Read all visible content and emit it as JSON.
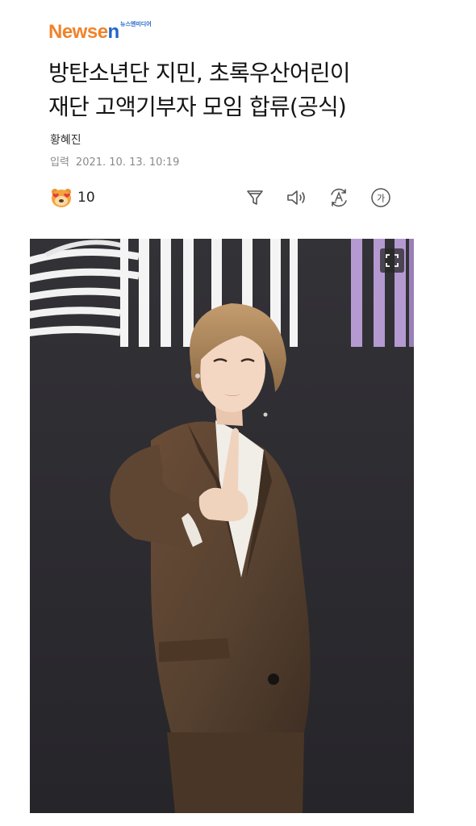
{
  "header": {
    "logo_main": "Newse",
    "logo_tail": "n",
    "logo_sub": "뉴스엔미디어"
  },
  "article": {
    "title_line1": "방탄소년단 지민, 초록우산어린이",
    "title_line2": "재단 고액기부자 모임 합류(공식)",
    "reporter": "황혜진",
    "date_label": "입력",
    "date_value": "2021. 10. 13. 10:19"
  },
  "reaction": {
    "icon": "love-eyes-face-icon",
    "count": "10"
  },
  "toolbar": {
    "items": [
      {
        "name": "filter-icon"
      },
      {
        "name": "speaker-icon"
      },
      {
        "name": "translate-icon"
      },
      {
        "name": "font-size-icon",
        "glyph": "가"
      }
    ]
  },
  "photo": {
    "subject": "person-in-brown-suit-pointing",
    "expand_icon": "expand-icon"
  },
  "colors": {
    "logo_orange": "#f0822a",
    "logo_blue": "#1f64c7",
    "backdrop": "#2d2c31",
    "suit_brown": "#5b4230"
  }
}
